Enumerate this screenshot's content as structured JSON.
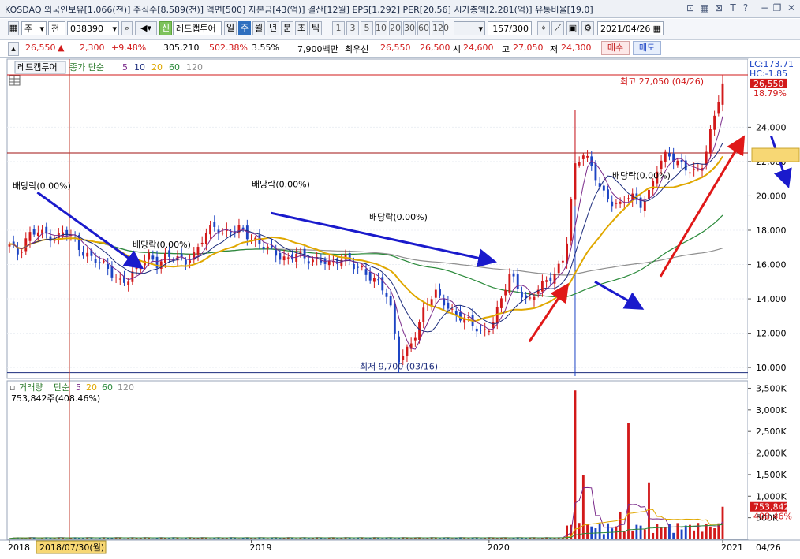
{
  "topbar": {
    "text": "KOSDAQ 외국인보유[1,066(천)] 주식수[8,589(천)] 액면[500] 자본금[43(억)] 결산[12월] EPS[1,292] PER[20.56] 시가총액[2,281(억)] 유통비율[19.0]",
    "icons": [
      "layout-icon",
      "table-icon",
      "close-box-icon",
      "text-icon",
      "help-icon",
      "minimize-icon",
      "window-icon",
      "close-icon"
    ]
  },
  "toolbar": {
    "chart_kind": "주",
    "market": "전",
    "code": "038390",
    "sin_label": "신",
    "stock_name": "레드캡투어",
    "period_buttons": [
      "일",
      "주",
      "월",
      "년",
      "분",
      "초",
      "틱"
    ],
    "active_period": "주",
    "count_buttons": [
      "1",
      "3",
      "5",
      "10",
      "20",
      "30",
      "60",
      "120"
    ],
    "range_value": "157/300",
    "date_value": "2021/04/26"
  },
  "quote": {
    "price": "26,550",
    "arrow": "▲",
    "change": "2,300",
    "change_rate": "+9.48%",
    "volume": "305,210",
    "volume_ratio": "502.38%",
    "turnover": "3.55%",
    "amount": "7,900백만",
    "best_ask_label": "최우선",
    "ask": "26,550",
    "bid": "26,500",
    "open_label": "시",
    "open": "24,600",
    "high_label": "고",
    "high": "27,050",
    "low_label": "저",
    "low": "24,300",
    "buy_label": "매수",
    "sell_label": "매도"
  },
  "price_panel": {
    "legend_name": "레드캡투어",
    "legend_series": "종가 단순",
    "ma_periods": [
      "5",
      "10",
      "20",
      "60",
      "120"
    ],
    "lc_text": "LC:173.71",
    "hc_text": "HC:-1.85",
    "current_tag": "26,550",
    "current_pct": "18.79%",
    "high_annotation": "최고 27,050 (04/26)",
    "low_annotation": "최저 9,700 (03/16)",
    "dividend_label": "배당락(0.00%)"
  },
  "volume_panel": {
    "legend_name": "거래량",
    "legend_series": "단순",
    "ma_periods": [
      "5",
      "20",
      "60",
      "120"
    ],
    "readout": "753,842주(408.46%)",
    "current_tag": "753,842",
    "current_pct": "408.46%"
  },
  "x_axis": {
    "labels": [
      "2018",
      "2019",
      "2020",
      "2021"
    ],
    "cursor_date": "2018/07/30(월)",
    "last_date": "04/26"
  },
  "colors": {
    "up": "#d2191a",
    "down": "#1c44c4",
    "ma5": "#7a2a8a",
    "ma10": "#1c2c7c",
    "ma20": "#e0a800",
    "ma60": "#2a8a3a",
    "ma120": "#8f8f8f",
    "trend_down": "#1a1acc",
    "trend_up": "#e01818",
    "yellow_box": "#f7d774"
  },
  "chart_data": [
    {
      "type": "candlestick",
      "title": "레드캡투어",
      "timeframe": "weekly",
      "y_ticks": [
        10000,
        12000,
        14000,
        16000,
        18000,
        20000,
        22000,
        24000
      ],
      "ylim": [
        9500,
        27050
      ],
      "x_labels": [
        "2018",
        "2019",
        "2020",
        "2021"
      ],
      "high": {
        "value": 27050,
        "date": "04/26"
      },
      "low": {
        "value": 9700,
        "date": "03/16"
      },
      "last_close": 26550,
      "close_path": [
        17200,
        16400,
        17600,
        18200,
        17800,
        17300,
        17900,
        17500,
        16800,
        16300,
        15900,
        15500,
        15100,
        15300,
        15800,
        16400,
        16100,
        16700,
        16300,
        16000,
        16600,
        17900,
        18300,
        17600,
        17900,
        18300,
        17600,
        17100,
        16800,
        16600,
        16400,
        16700,
        16100,
        16200,
        16400,
        16100,
        16300,
        15900,
        15800,
        15400,
        14800,
        13800,
        10500,
        11200,
        12200,
        13600,
        14300,
        13900,
        13200,
        12800,
        12400,
        12000,
        12600,
        13800,
        15300,
        14500,
        13900,
        14700,
        14900,
        15400,
        16600,
        21800,
        22500,
        21300,
        20200,
        19800,
        19500,
        20000,
        19300,
        20200,
        21900,
        22400,
        21800,
        21700,
        21500,
        22000,
        24300,
        26550
      ],
      "moving_averages": [
        "5",
        "10",
        "20",
        "60",
        "120"
      ]
    },
    {
      "type": "bar",
      "title": "거래량",
      "y_ticks": [
        500000,
        1000000,
        1500000,
        2000000,
        2500000,
        3000000,
        3500000
      ],
      "ylim": [
        0,
        3600000
      ],
      "spikes": [
        {
          "x_index": 61,
          "value": 3450000
        },
        {
          "x_index": 62,
          "value": 1480000
        },
        {
          "x_index": 66,
          "value": 640000
        },
        {
          "x_index": 67,
          "value": 2700000
        },
        {
          "x_index": 69,
          "value": 1320000
        },
        {
          "x_index": 77,
          "value": 753842
        }
      ],
      "last_value": 753842,
      "last_ratio": "408.46%"
    }
  ]
}
